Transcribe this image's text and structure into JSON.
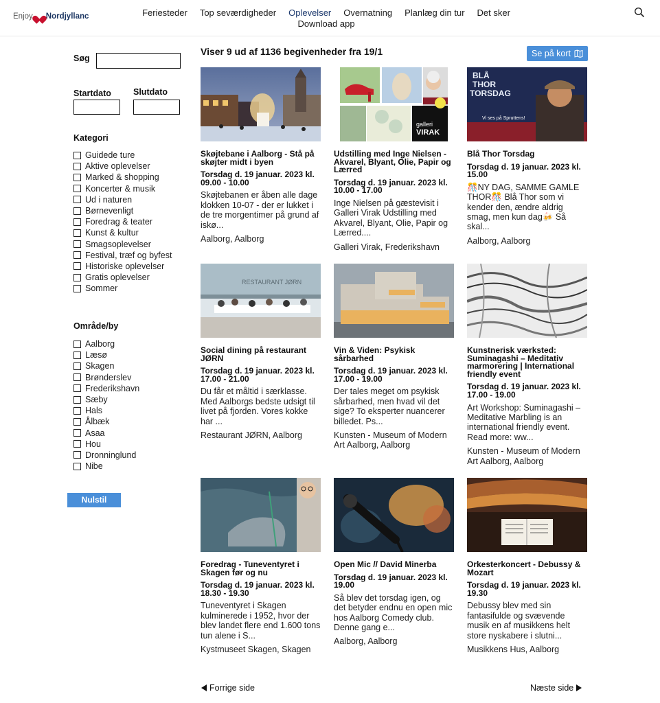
{
  "header": {
    "logo_enjoy": "Enjoy",
    "logo_brand": "Nordjyllanc",
    "nav": [
      {
        "label": "Feriesteder",
        "active": false
      },
      {
        "label": "Top seværdigheder",
        "active": false
      },
      {
        "label": "Oplevelser",
        "active": true
      },
      {
        "label": "Overnatning",
        "active": false
      },
      {
        "label": "Planlæg din tur",
        "active": false
      },
      {
        "label": "Det sker",
        "active": false
      }
    ],
    "nav_second_row": "Download app"
  },
  "sidebar": {
    "search_label": "Søg",
    "search_value": "",
    "startdato_label": "Startdato",
    "slutdato_label": "Slutdato",
    "kategori_title": "Kategori",
    "kategorier": [
      "Guidede ture",
      "Aktive oplevelser",
      "Marked & shopping",
      "Koncerter & musik",
      "Ud i naturen",
      "Børnevenligt",
      "Foredrag & teater",
      "Kunst & kultur",
      "Smagsoplevelser",
      "Festival, træf og byfest",
      "Historiske oplevelser",
      "Gratis oplevelser",
      "Sommer"
    ],
    "omraade_title": "Område/by",
    "omraader": [
      "Aalborg",
      "Læsø",
      "Skagen",
      "Brønderslev",
      "Frederikshavn",
      "Sæby",
      "Hals",
      "Ålbæk",
      "Asaa",
      "Hou",
      "Dronninglund",
      "Nibe"
    ],
    "reset_label": "Nulstil"
  },
  "main": {
    "results_title": "Viser 9 ud af 1136 begivenheder fra 19/1",
    "map_button": "Se på kort",
    "cards": [
      {
        "title": "Skøjtebane i Aalborg - Stå på skøjter midt i byen",
        "date": "Torsdag d. 19 januar. 2023 kl. 09.00 - 10.00",
        "desc": "Skøjtebanen er åben alle dage klokken 10-07 - der er lukket i de tre morgentimer på grund af iskø...",
        "place": "Aalborg, Aalborg"
      },
      {
        "title": "Udstilling med Inge Nielsen - Akvarel, Blyant, Olie, Papir og Lærred",
        "date": "Torsdag d. 19 januar. 2023 kl. 10.00 - 17.00",
        "desc": "Inge Nielsen på gæstevisit i Galleri Virak Udstilling med Akvarel, Blyant, Olie, Papir og Lærred....",
        "place": "Galleri Virak, Frederikshavn",
        "img_text": "galleri VIRAK"
      },
      {
        "title": "Blå Thor Torsdag",
        "date": "Torsdag d. 19 januar. 2023 kl. 15.00",
        "desc": "🎊NY DAG, SAMME GAMLE THOR🎊 Blå Thor som vi kender den, ændre aldrig smag, men kun dag🍻 Så skal...",
        "place": "Aalborg, Aalborg",
        "img_text": "BLÅ THOR TORSDAG",
        "img_sub": "Vi ses på Spruttens!"
      },
      {
        "title": "Social dining på restaurant JØRN",
        "date": "Torsdag d. 19 januar. 2023 kl. 17.00 - 21.00",
        "desc": "Du får et måltid i særklasse. Med Aalborgs bedste udsigt til livet på fjorden. Vores kokke har ...",
        "place": "Restaurant JØRN, Aalborg",
        "img_text": "RESTAURANT JØRN"
      },
      {
        "title": "Vin & Viden: Psykisk sårbarhed",
        "date": "Torsdag d. 19 januar. 2023 kl. 17.00 - 19.00",
        "desc": "Der tales meget om psykisk sårbarhed, men hvad vil det sige? To eksperter nuancerer billedet. Ps...",
        "place": "Kunsten - Museum of Modern Art Aalborg, Aalborg"
      },
      {
        "title": "Kunstnerisk værksted: Suminagashi – Meditativ marmorering | International friendly event",
        "date": "Torsdag d. 19 januar. 2023 kl. 17.00 - 19.00",
        "desc": "Art Workshop: Suminagashi – Meditative Marbling is an international friendly event. Read more: ww...",
        "place": "Kunsten - Museum of Modern Art Aalborg, Aalborg"
      },
      {
        "title": "Foredrag - Tuneventyret i Skagen før og nu",
        "date": "Torsdag d. 19 januar. 2023 kl. 18.30 - 19.30",
        "desc": "Tuneventyret i Skagen kulminerede i 1952, hvor der blev landet flere end 1.600 tons tun alene i S...",
        "place": "Kystmuseet Skagen, Skagen"
      },
      {
        "title": "Open Mic // David Minerba",
        "date": "Torsdag d. 19 januar. 2023 kl. 19.00",
        "desc": "Så blev det torsdag igen, og det betyder endnu en open mic hos Aalborg Comedy club. Denne gang e...",
        "place": "Aalborg, Aalborg"
      },
      {
        "title": "Orkesterkoncert - Debussy & Mozart",
        "date": "Torsdag d. 19 januar. 2023 kl. 19.30",
        "desc": "Debussy blev med sin fantasifulde og svævende musik en af musikkens helt store nyskabere i slutni...",
        "place": "Musikkens Hus, Aalborg"
      }
    ],
    "prev_label": "Forrige side",
    "next_label": "Næste side"
  },
  "colors": {
    "accent": "#4a8fd9",
    "nav_active": "#1d3a6e",
    "brand": "#1d3763",
    "heart": "#c8102e"
  }
}
